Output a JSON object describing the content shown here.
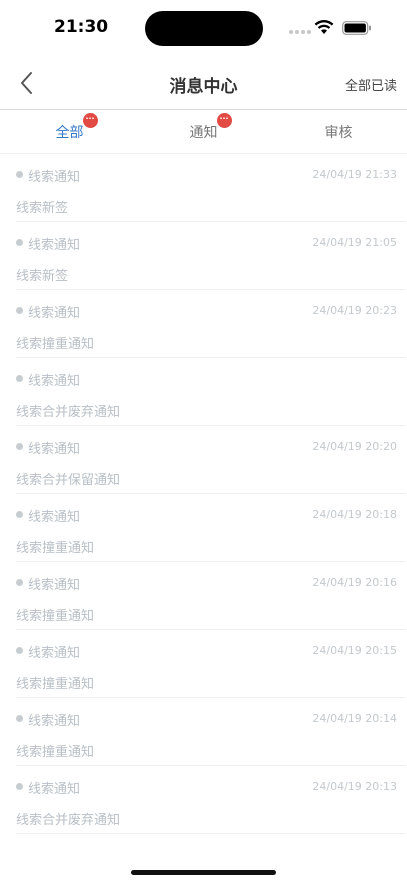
{
  "status_bar": {
    "time": "21:30"
  },
  "nav": {
    "title": "消息中心",
    "mark_all_read": "全部已读"
  },
  "tabs": [
    {
      "label": "全部",
      "badge": "···",
      "active": true
    },
    {
      "label": "通知",
      "badge": "···",
      "active": false
    },
    {
      "label": "审核",
      "badge": "",
      "active": false
    }
  ],
  "messages": [
    {
      "type": "线索通知",
      "time": "24/04/19 21:33",
      "content": "线索新签"
    },
    {
      "type": "线索通知",
      "time": "24/04/19 21:05",
      "content": "线索新签"
    },
    {
      "type": "线索通知",
      "time": "24/04/19 20:23",
      "content": "线索撞重通知"
    },
    {
      "type": "线索通知",
      "time": "",
      "content": "线索合并废弃通知"
    },
    {
      "type": "线索通知",
      "time": "24/04/19 20:20",
      "content": "线索合并保留通知"
    },
    {
      "type": "线索通知",
      "time": "24/04/19 20:18",
      "content": "线索撞重通知"
    },
    {
      "type": "线索通知",
      "time": "24/04/19 20:16",
      "content": "线索撞重通知"
    },
    {
      "type": "线索通知",
      "time": "24/04/19 20:15",
      "content": "线索撞重通知"
    },
    {
      "type": "线索通知",
      "time": "24/04/19 20:14",
      "content": "线索撞重通知"
    },
    {
      "type": "线索通知",
      "time": "24/04/19 20:13",
      "content": "线索合并废弃通知"
    }
  ],
  "colors": {
    "accent": "#3478c6",
    "badge": "#e24a44",
    "muted_text": "#b8bfc6"
  }
}
